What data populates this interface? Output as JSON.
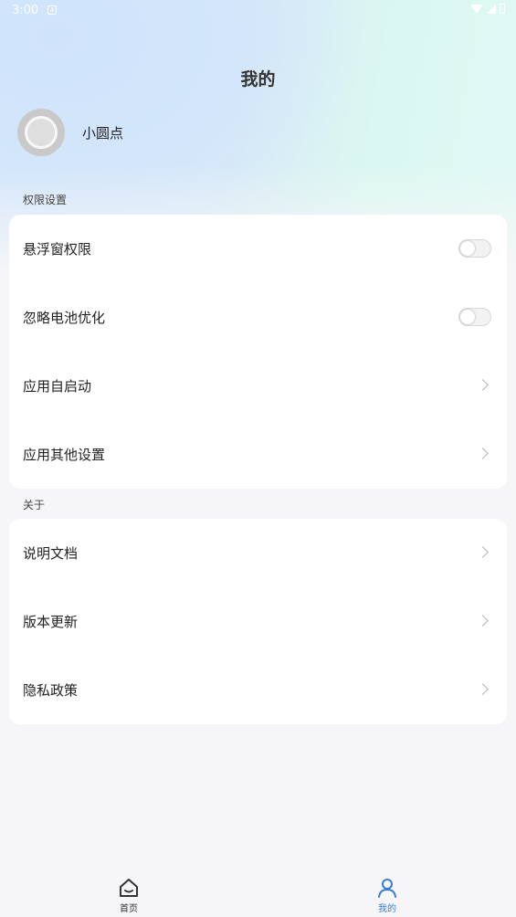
{
  "status_bar": {
    "time": "3:00",
    "notif": "A"
  },
  "header": {
    "title": "我的"
  },
  "profile": {
    "name": "小圆点"
  },
  "sections": {
    "permissions": {
      "label": "权限设置",
      "items": [
        {
          "label": "悬浮窗权限",
          "type": "toggle",
          "enabled": false
        },
        {
          "label": "忽略电池优化",
          "type": "toggle",
          "enabled": false
        },
        {
          "label": "应用自启动",
          "type": "link"
        },
        {
          "label": "应用其他设置",
          "type": "link"
        }
      ]
    },
    "about": {
      "label": "关于",
      "items": [
        {
          "label": "说明文档",
          "type": "link"
        },
        {
          "label": "版本更新",
          "type": "link"
        },
        {
          "label": "隐私政策",
          "type": "link"
        }
      ]
    }
  },
  "tabbar": {
    "tabs": [
      {
        "label": "首页",
        "icon": "home-icon",
        "active": false
      },
      {
        "label": "我的",
        "icon": "user-icon",
        "active": true
      }
    ]
  },
  "colors": {
    "accent": "#3a7bd5",
    "inactive_tab": "#333333"
  }
}
